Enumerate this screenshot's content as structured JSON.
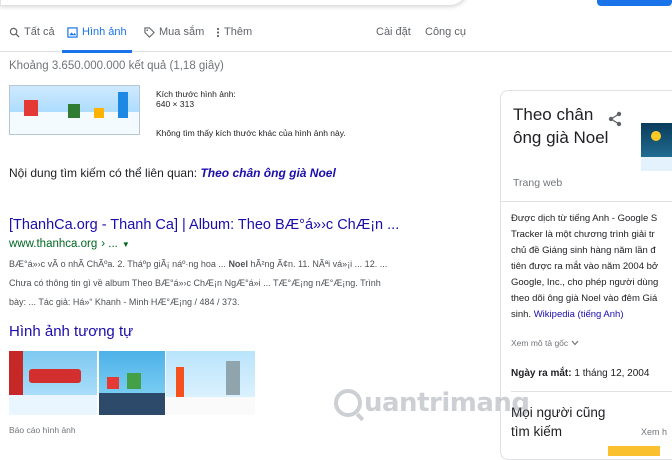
{
  "tabs": [
    {
      "label": "Tất cả",
      "icon": "search-icon"
    },
    {
      "label": "Hình ảnh",
      "icon": "image-icon"
    },
    {
      "label": "Mua sắm",
      "icon": "tag-icon"
    },
    {
      "label": "Thêm",
      "icon": "more-vert-icon"
    }
  ],
  "tools": {
    "settings": "Cài đặt",
    "tools": "Công cụ"
  },
  "result_stats": "Khoảng 3.650.000.000 kết quả (1,18 giây)",
  "image_info": {
    "size_label": "Kích thước hình ảnh:",
    "size_value": "640 × 313",
    "not_found": "Không tìm thấy kích thước khác của hình ảnh này."
  },
  "related": {
    "prefix": "Nội dung tìm kiếm có thể liên quan:",
    "query": "Theo chân ông già Noel"
  },
  "result": {
    "title": "[ThanhCa.org - Thanh Ca] | Album: Theo BÆ°á»›c ChÆ¡n ...",
    "url": "www.thanhca.org",
    "url_more": "› ...",
    "line1_pre": "BÆ°á»›c vÃ o nhÃ ChÃºa. 2. Tháº­p giÃ¡ náº·ng hoa ...",
    "line1_bold": "Noel",
    "line1_post": "hÃ²ng Ã¢n. 11. NÃªi vá»¡i ... 12. ...",
    "line2": "Chưa có thông tin gì về album Theo BÆ°á»›c ChÆ¡n NgÆ°á»i ... TÆ°Æ¡ng nÆ°Æ¡ng. Trình",
    "line3": "bày: ... Tác giả: Há»“ Khanh - Minh HÆ°Æ¡ng / 484 / 373."
  },
  "similar": {
    "title": "Hình ảnh tương tự",
    "report": "Báo cáo hình ảnh"
  },
  "knowledge_panel": {
    "title": "Theo chân ông già Noel",
    "subtitle": "Trang web",
    "desc_lines": [
      "Được dịch từ tiếng Anh - Google S",
      "Tracker là một chương trình giải tr",
      "chủ đề Giáng sinh hàng năm lần đ",
      "tiên được ra mắt vào năm 2004 bở",
      "Google, Inc., cho phép người dùng",
      "theo dõi ông già Noel vào đêm Giá"
    ],
    "desc_last": "sinh.",
    "wiki_link": "Wikipedia (tiếng Anh)",
    "see_original": "Xem mô tả gốc",
    "date_label": "Ngày ra mắt:",
    "date_value": "1 tháng 12, 2004",
    "people_title": "Mọi người cũng tìm kiếm",
    "people_more": "Xem h"
  },
  "watermark": "uantrimang",
  "colors": {
    "link": "#1a0dab",
    "accent": "#1a73e8",
    "url": "#006621"
  }
}
